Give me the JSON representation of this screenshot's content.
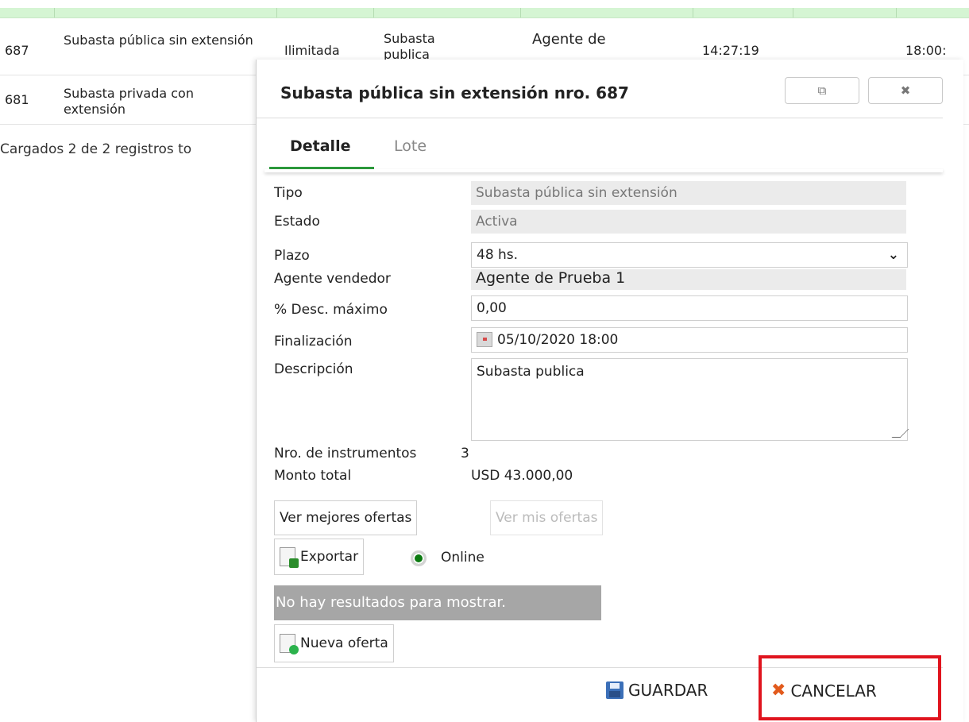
{
  "grid": {
    "rows": [
      {
        "id": "687",
        "name": "Subasta pública sin extensión",
        "plazo": "Ilimitada",
        "tipo": "Subasta publica",
        "agente": "Agente de",
        "hora": "14:27:19",
        "fin": "18:00:"
      },
      {
        "id": "681",
        "name": "Subasta privada con extensión"
      }
    ],
    "footer": "Cargados 2 de 2 registros to"
  },
  "dialog": {
    "title": "Subasta pública sin extensión nro. 687",
    "restore_icon": "restore-window-icon",
    "close_icon": "close-icon",
    "tabs": [
      {
        "label": "Detalle",
        "active": true
      },
      {
        "label": "Lote",
        "active": false
      }
    ],
    "fields": {
      "tipo": {
        "label": "Tipo",
        "value": "Subasta pública sin extensión"
      },
      "estado": {
        "label": "Estado",
        "value": "Activa"
      },
      "plazo": {
        "label": "Plazo",
        "value": "48 hs."
      },
      "agente": {
        "label": "Agente vendedor",
        "value": "Agente de Prueba 1"
      },
      "desc_max": {
        "label": "% Desc. máximo",
        "value": "0,00"
      },
      "finalizacion": {
        "label": "Finalización",
        "value": "05/10/2020 18:00"
      },
      "descripcion": {
        "label": "Descripción",
        "value": "Subasta publica"
      }
    },
    "instrumentos": {
      "label": "Nro. de instrumentos",
      "value": "3"
    },
    "monto": {
      "label": "Monto total",
      "value": "USD 43.000,00"
    },
    "buttons": {
      "mejores": "Ver mejores ofertas",
      "mis": "Ver mis ofertas",
      "exportar": "Exportar",
      "online": "Online",
      "nueva": "Nueva oferta"
    },
    "no_results": "No hay resultados para mostrar.",
    "actions": {
      "guardar": "GUARDAR",
      "cancelar": "CANCELAR"
    },
    "colors": {
      "tab_accent": "#2c9a3c",
      "highlight": "#e0141e",
      "online": "#0b7a10"
    }
  }
}
